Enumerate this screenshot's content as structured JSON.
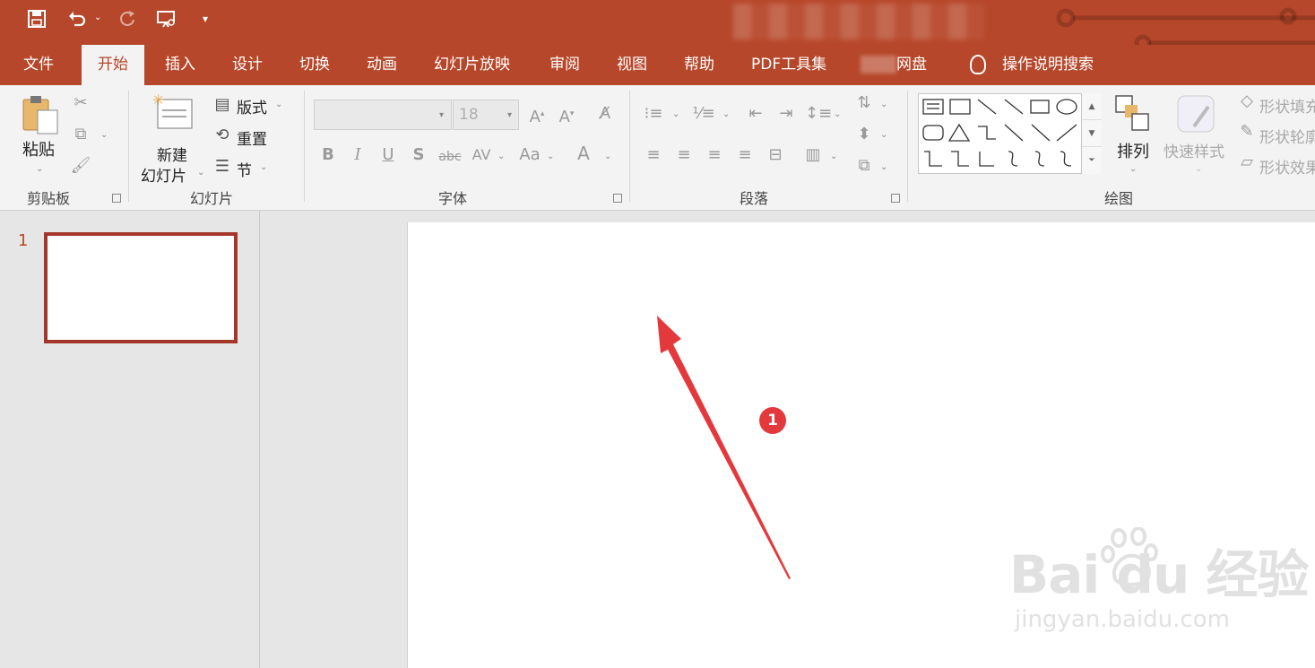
{
  "quick_access": {
    "save_icon": "save-icon",
    "undo_icon": "undo-icon",
    "redo_icon": "redo-icon",
    "present_icon": "present-icon",
    "customize_icon": "customize-icon"
  },
  "tabs": [
    {
      "label": "文件"
    },
    {
      "label": "开始"
    },
    {
      "label": "插入"
    },
    {
      "label": "设计"
    },
    {
      "label": "切换"
    },
    {
      "label": "动画"
    },
    {
      "label": "幻灯片放映"
    },
    {
      "label": "审阅"
    },
    {
      "label": "视图"
    },
    {
      "label": "帮助"
    },
    {
      "label": "PDF工具集"
    },
    {
      "label": "网盘"
    }
  ],
  "tell_me": "操作说明搜索",
  "ribbon": {
    "clipboard": {
      "paste": "粘贴",
      "label": "剪贴板"
    },
    "slides": {
      "new_slide_line1": "新建",
      "new_slide_line2": "幻灯片",
      "layout": "版式",
      "reset": "重置",
      "section": "节",
      "label": "幻灯片"
    },
    "font": {
      "size": "18",
      "label": "字体"
    },
    "paragraph": {
      "label": "段落"
    },
    "drawing": {
      "arrange": "排列",
      "quick_styles": "快速样式",
      "shape_fill": "形状填充",
      "shape_outline": "形状轮廓",
      "shape_effects": "形状效果",
      "label": "绘图"
    }
  },
  "slides_pane": {
    "slide_number": "1"
  },
  "annotation": {
    "step": "1"
  },
  "watermark": {
    "brand": "Bai du 经验",
    "url": "jingyan.baidu.com"
  },
  "colors": {
    "accent": "#b7472a",
    "badge": "#e4393c",
    "arrow": "#e4393c"
  }
}
